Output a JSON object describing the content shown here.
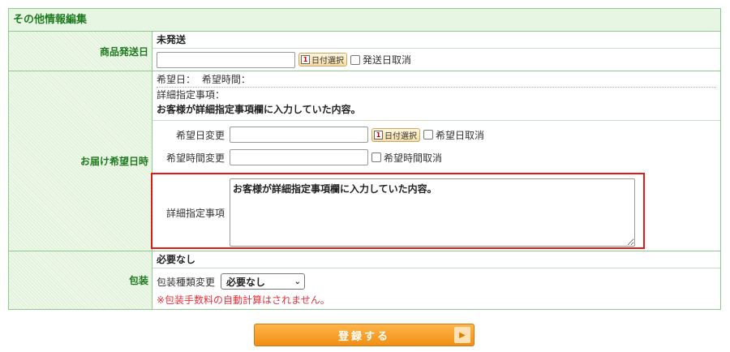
{
  "section": {
    "title": "その他情報編集"
  },
  "shipping": {
    "label": "商品発送日",
    "status": "未発送",
    "date_value": "",
    "cal_button": "日付選択",
    "cal_icon": "1",
    "cancel_label": "発送日取消"
  },
  "delivery": {
    "label": "お届け希望日時",
    "info": {
      "desired_date_label": "希望日：",
      "desired_time_label": "希望時間：",
      "detail_label": "詳細指定事項：",
      "detail_text": "お客様が詳細指定事項欄に入力していた内容。"
    },
    "change_date": {
      "label": "希望日変更",
      "value": "",
      "cal_button": "日付選択",
      "cal_icon": "1",
      "cancel_label": "希望日取消"
    },
    "change_time": {
      "label": "希望時間変更",
      "value": "",
      "cancel_label": "希望時間取消"
    },
    "detail_edit": {
      "label": "詳細指定事項",
      "value": "お客様が詳細指定事項欄に入力していた内容。"
    }
  },
  "packaging": {
    "label": "包装",
    "status": "必要なし",
    "change_label": "包装種類変更",
    "selected": "必要なし",
    "note": "※包装手数料の自動計算はされません。"
  },
  "submit": {
    "label": "登録する",
    "arrow": "▶"
  },
  "colors": {
    "accent_green": "#1f7a1f",
    "highlight_red": "#e51717",
    "note_red": "#e5323b",
    "button_orange": "#f08f14"
  }
}
